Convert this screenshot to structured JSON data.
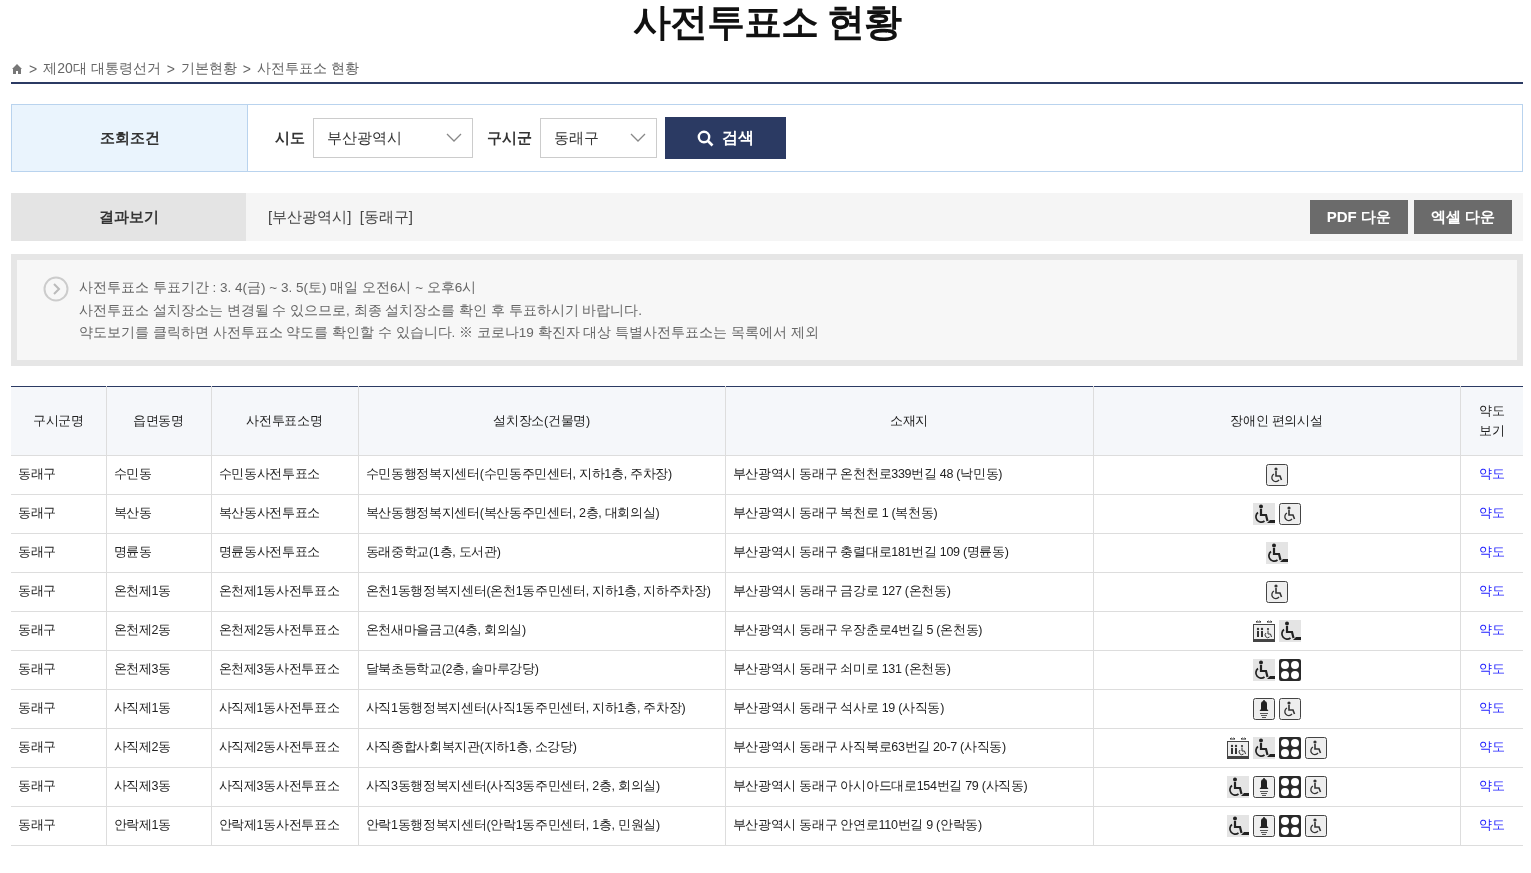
{
  "page_title": "사전투표소 현황",
  "breadcrumb": [
    {
      "separator": ">",
      "label": "제20대 대통령선거"
    },
    {
      "separator": ">",
      "label": "기본현황"
    },
    {
      "separator": ">",
      "label": "사전투표소 현황"
    }
  ],
  "search": {
    "label": "조회조건",
    "fields": [
      {
        "label": "시도",
        "value": "부산광역시"
      },
      {
        "label": "구시군",
        "value": "동래구"
      }
    ],
    "button": "검색"
  },
  "result": {
    "label": "결과보기",
    "summary": "[부산광역시]  [동래구]",
    "buttons": [
      "PDF 다운",
      "엑셀 다운"
    ]
  },
  "notice": [
    "사전투표소 투표기간 : 3. 4(금) ~ 3. 5(토) 매일 오전6시 ~ 오후6시",
    "사전투표소 설치장소는 변경될 수 있으므로, 최종 설치장소를 확인 후 투표하시기 바랍니다.",
    "약도보기를 클릭하면 사전투표소 약도를 확인할 수 있습니다. ※ 코로나19 확진자 대상 특별사전투표소는 목록에서 제외"
  ],
  "table": {
    "columns": [
      "구시군명",
      "읍면동명",
      "사전투표소명",
      "설치장소(건물명)",
      "소재지",
      "장애인 편의시설",
      "약도\n보기"
    ],
    "rows": [
      {
        "district": "동래구",
        "dong": "수민동",
        "station": "수민동사전투표소",
        "place": "수민동행정복지센터(수민동주민센터, 지하1층, 주차장)",
        "address": "부산광역시 동래구 온천천로339번길 48 (낙민동)",
        "facilities": [
          {
            "kind": "wheelchair"
          }
        ],
        "map": "약도"
      },
      {
        "district": "동래구",
        "dong": "복산동",
        "station": "복산동사전투표소",
        "place": "복산동행정복지센터(복산동주민센터, 2층, 대회의실)",
        "address": "부산광역시 동래구 복천로 1 (복천동)",
        "facilities": [
          {
            "kind": "ramp"
          },
          {
            "kind": "wheelchair"
          }
        ],
        "map": "약도"
      },
      {
        "district": "동래구",
        "dong": "명륜동",
        "station": "명륜동사전투표소",
        "place": "동래중학교(1층, 도서관)",
        "address": "부산광역시 동래구 충렬대로181번길 109 (명륜동)",
        "facilities": [
          {
            "kind": "ramp"
          }
        ],
        "map": "약도"
      },
      {
        "district": "동래구",
        "dong": "온천제1동",
        "station": "온천제1동사전투표소",
        "place": "온천1동행정복지센터(온천1동주민센터, 지하1층, 지하주차장)",
        "address": "부산광역시 동래구 금강로 127 (온천동)",
        "facilities": [
          {
            "kind": "wheelchair"
          }
        ],
        "map": "약도"
      },
      {
        "district": "동래구",
        "dong": "온천제2동",
        "station": "온천제2동사전투표소",
        "place": "온천새마을금고(4층, 회의실)",
        "address": "부산광역시 동래구 우장춘로4번길 5 (온천동)",
        "facilities": [
          {
            "kind": "elevator"
          },
          {
            "kind": "ramp"
          }
        ],
        "map": "약도"
      },
      {
        "district": "동래구",
        "dong": "온천제3동",
        "station": "온천제3동사전투표소",
        "place": "달북초등학교(2층, 솔마루강당)",
        "address": "부산광역시 동래구 쇠미로 131 (온천동)",
        "facilities": [
          {
            "kind": "ramp"
          },
          {
            "kind": "dots"
          }
        ],
        "map": "약도"
      },
      {
        "district": "동래구",
        "dong": "사직제1동",
        "station": "사직제1동사전투표소",
        "place": "사직1동행정복지센터(사직1동주민센터, 지하1층, 주차장)",
        "address": "부산광역시 동래구 석사로 19 (사직동)",
        "facilities": [
          {
            "kind": "bell"
          },
          {
            "kind": "wheelchair"
          }
        ],
        "map": "약도"
      },
      {
        "district": "동래구",
        "dong": "사직제2동",
        "station": "사직제2동사전투표소",
        "place": "사직종합사회복지관(지하1층, 소강당)",
        "address": "부산광역시 동래구 사직북로63번길 20-7 (사직동)",
        "facilities": [
          {
            "kind": "elevator"
          },
          {
            "kind": "ramp"
          },
          {
            "kind": "dots"
          },
          {
            "kind": "wheelchair"
          }
        ],
        "map": "약도"
      },
      {
        "district": "동래구",
        "dong": "사직제3동",
        "station": "사직제3동사전투표소",
        "place": "사직3동행정복지센터(사직3동주민센터, 2층, 회의실)",
        "address": "부산광역시 동래구 아시아드대로154번길 79 (사직동)",
        "facilities": [
          {
            "kind": "ramp"
          },
          {
            "kind": "bell"
          },
          {
            "kind": "dots"
          },
          {
            "kind": "wheelchair"
          }
        ],
        "map": "약도"
      },
      {
        "district": "동래구",
        "dong": "안락제1동",
        "station": "안락제1동사전투표소",
        "place": "안락1동행정복지센터(안락1동주민센터, 1층, 민원실)",
        "address": "부산광역시 동래구 안연로110번길 9 (안락동)",
        "facilities": [
          {
            "kind": "ramp"
          },
          {
            "kind": "bell"
          },
          {
            "kind": "dots"
          },
          {
            "kind": "wheelchair"
          }
        ],
        "map": "약도"
      }
    ]
  }
}
